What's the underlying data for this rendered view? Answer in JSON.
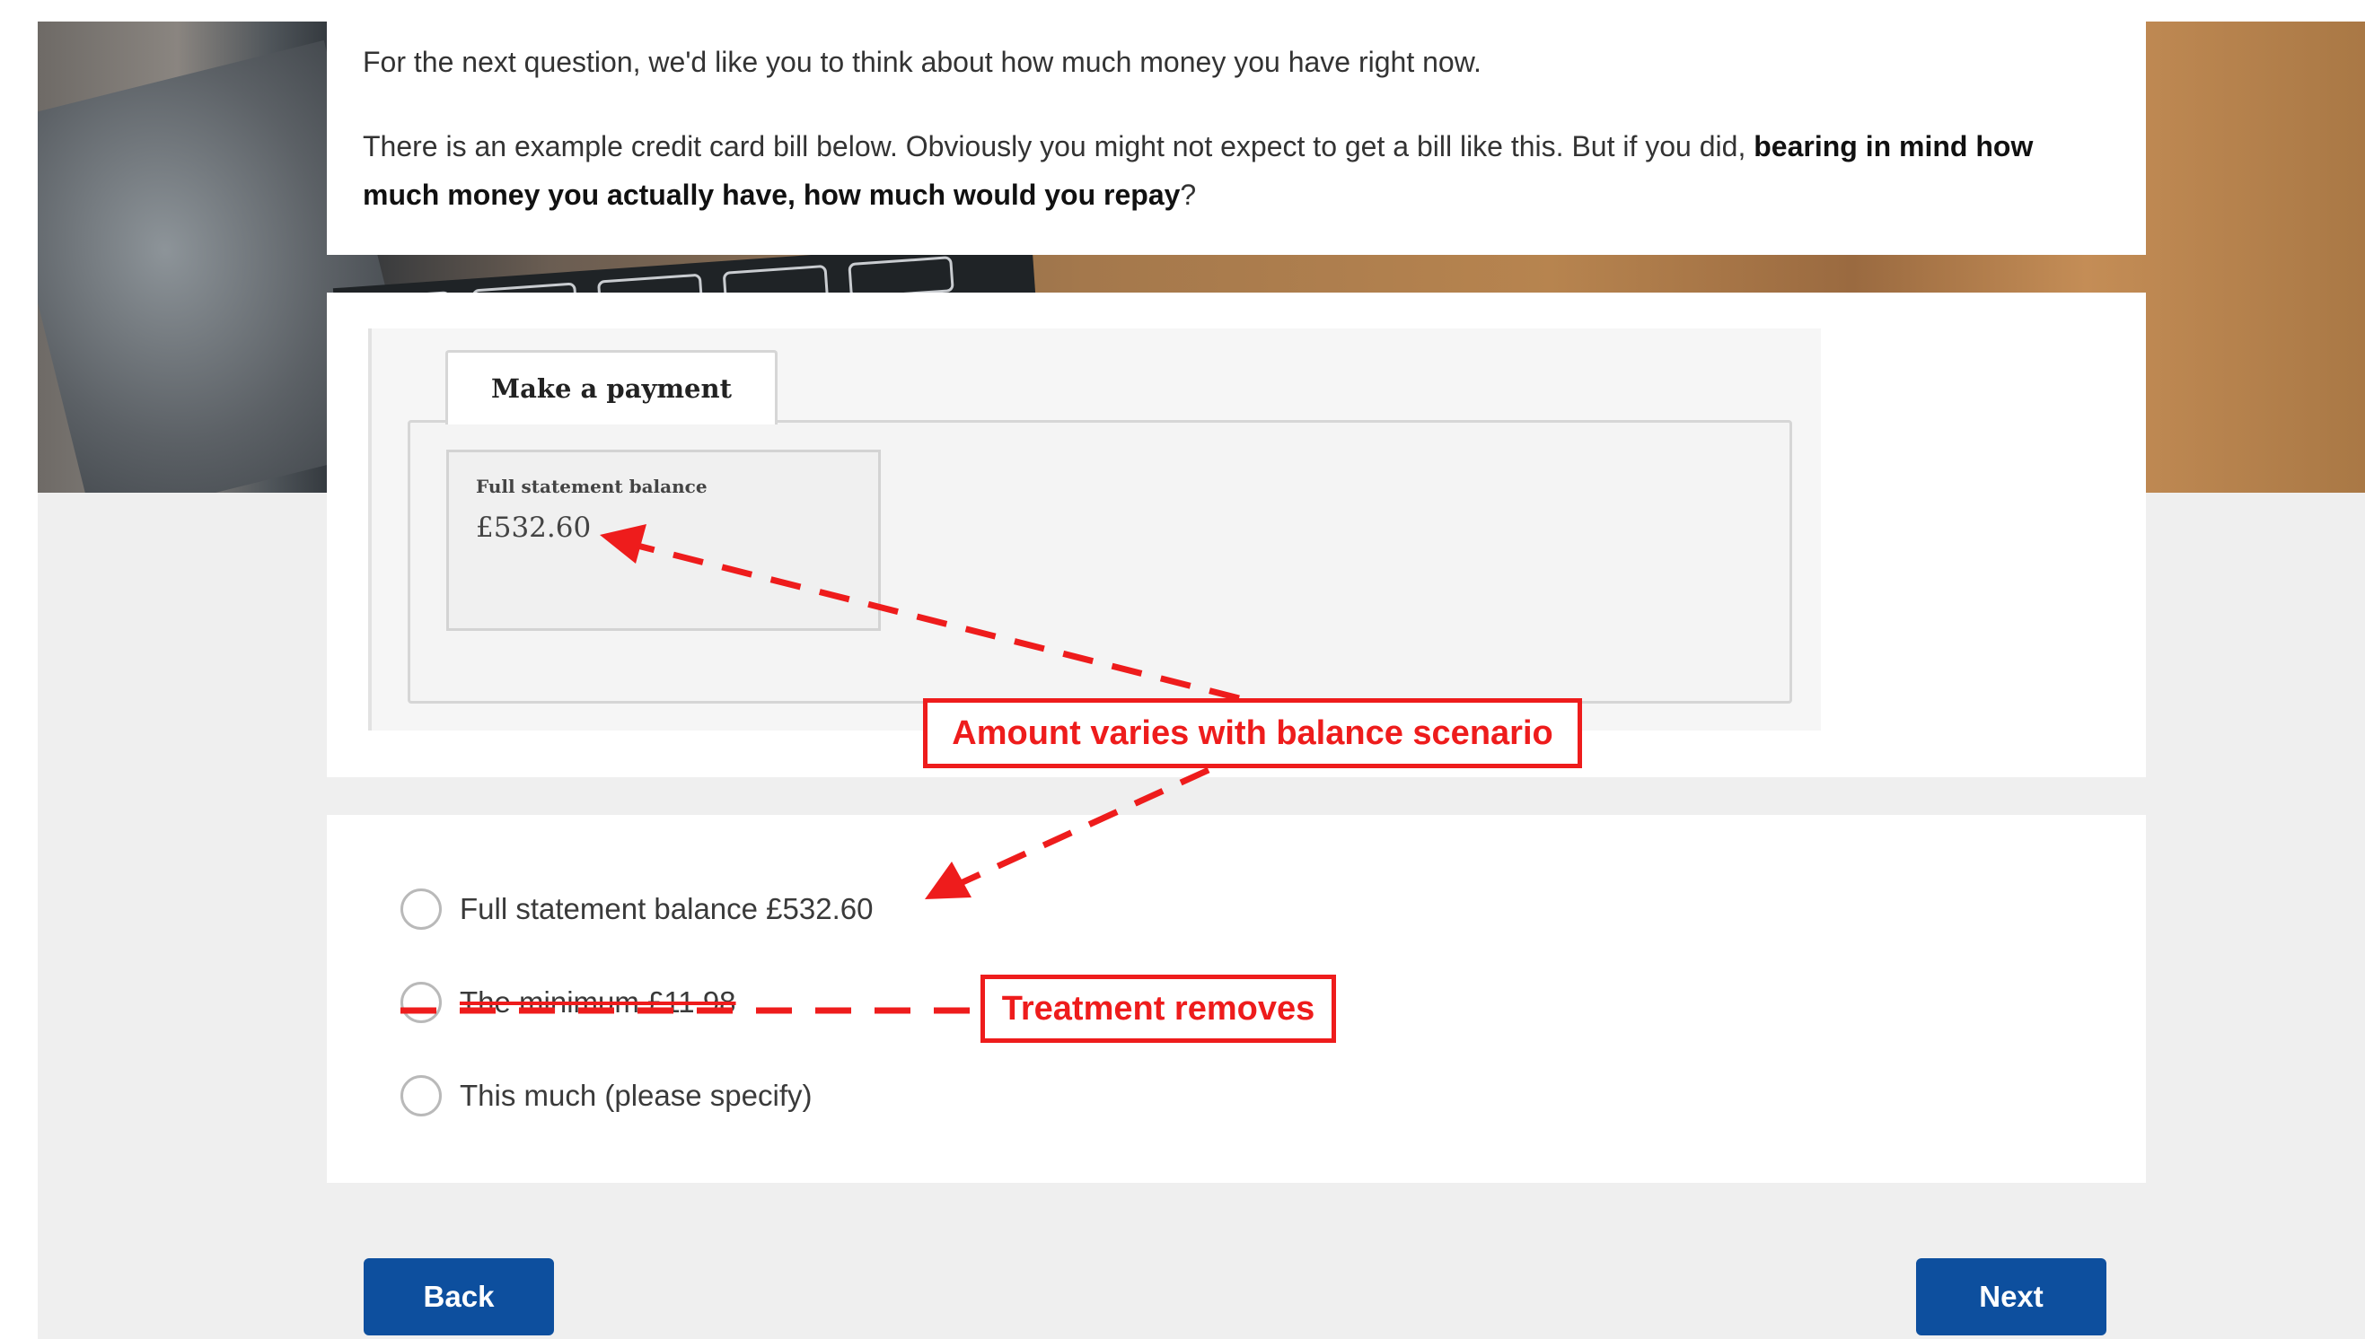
{
  "question": {
    "intro": "For the next question, we'd like you to think about how much money you have right now.",
    "body_plain": "There is an example credit card bill below. Obviously you might not expect to get a bill like this. But if you did, ",
    "body_bold": "bearing in mind how much money you actually have, how much would you repay",
    "body_end": "?"
  },
  "payment": {
    "tab_label": "Make a payment",
    "balance_label": "Full statement balance",
    "balance_amount": "£532.60"
  },
  "options": [
    {
      "label": "Full statement balance £532.60"
    },
    {
      "label": "The minimum £11.98"
    },
    {
      "label": "This much (please specify)"
    }
  ],
  "buttons": {
    "back": "Back",
    "next": "Next"
  },
  "annotations": {
    "amount_note": "Amount varies with balance scenario",
    "treatment_note": "Treatment removes"
  },
  "colors": {
    "primary_button": "#0d4f9e",
    "annotation_red": "#ee1c1c",
    "page_background": "#efefef"
  }
}
